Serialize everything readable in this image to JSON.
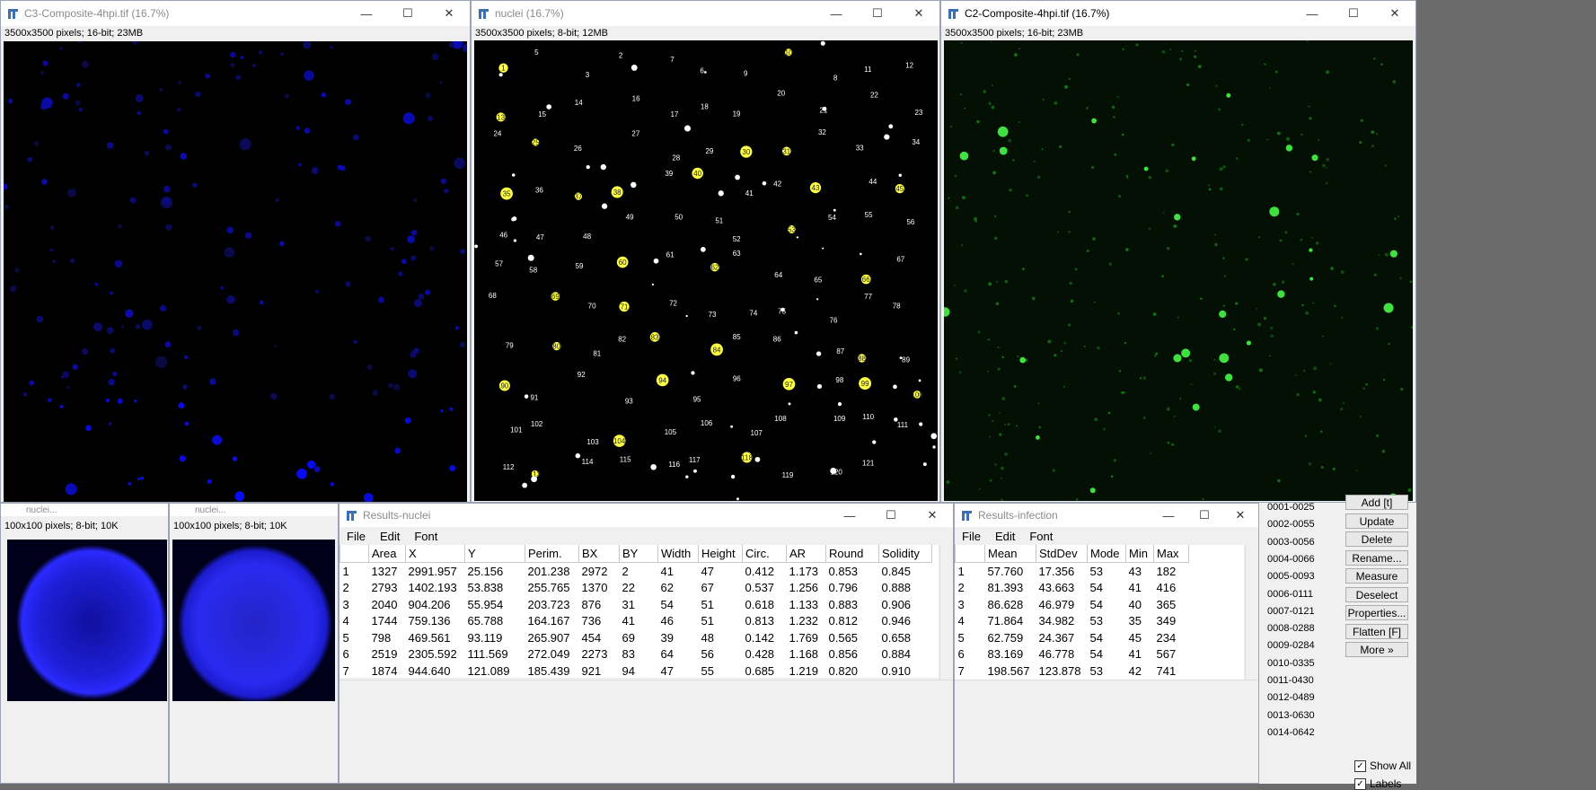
{
  "windows": {
    "c3": {
      "title": "C3-Composite-4hpi.tif (16.7%)",
      "info": "3500x3500 pixels; 16-bit; 23MB"
    },
    "nuclei": {
      "title": "nuclei (16.7%)",
      "info": "3500x3500 pixels; 8-bit; 12MB"
    },
    "c2": {
      "title": "C2-Composite-4hpi.tif (16.7%)",
      "info": "3500x3500 pixels; 16-bit; 23MB"
    },
    "crop1": {
      "title": "nuclei...",
      "info": "100x100 pixels; 8-bit; 10K"
    },
    "crop2": {
      "title": "nuclei...",
      "info": "100x100 pixels; 8-bit; 10K"
    }
  },
  "controls": {
    "minimize": "—",
    "maximize": "☐",
    "close": "✕"
  },
  "nuclei_labels": [
    "1",
    "5",
    "3",
    "2",
    "7",
    "6",
    "9",
    "10",
    "8",
    "11",
    "12",
    "13",
    "15",
    "14",
    "16",
    "17",
    "18",
    "19",
    "20",
    "21",
    "22",
    "23",
    "24",
    "25",
    "26",
    "27",
    "28",
    "29",
    "30",
    "31",
    "32",
    "33",
    "34",
    "35",
    "36",
    "37",
    "38",
    "39",
    "40",
    "41",
    "42",
    "43",
    "44",
    "45",
    "46",
    "47",
    "48",
    "49",
    "50",
    "51",
    "52",
    "53",
    "54",
    "55",
    "56",
    "57",
    "58",
    "59",
    "60",
    "61",
    "62",
    "63",
    "64",
    "65",
    "66",
    "67",
    "68",
    "69",
    "70",
    "71",
    "72",
    "73",
    "74",
    "75",
    "76",
    "77",
    "78",
    "79",
    "80",
    "81",
    "82",
    "83",
    "84",
    "85",
    "86",
    "87",
    "88",
    "89",
    "90",
    "91",
    "92",
    "93",
    "94",
    "95",
    "96",
    "97",
    "98",
    "99",
    "100",
    "101",
    "102",
    "103",
    "104",
    "105",
    "106",
    "107",
    "108",
    "109",
    "110",
    "111",
    "112",
    "113",
    "114",
    "115",
    "116",
    "117",
    "118",
    "119",
    "120",
    "121"
  ],
  "results_nuclei": {
    "title": "Results-nuclei",
    "menu": [
      "File",
      "Edit",
      "Font"
    ],
    "columns": [
      "",
      "Area",
      "X",
      "Y",
      "Perim.",
      "BX",
      "BY",
      "Width",
      "Height",
      "Circ.",
      "AR",
      "Round",
      "Solidity"
    ],
    "rows": [
      [
        "1",
        "1327",
        "2991.957",
        "25.156",
        "201.238",
        "2972",
        "2",
        "41",
        "47",
        "0.412",
        "1.173",
        "0.853",
        "0.845"
      ],
      [
        "2",
        "2793",
        "1402.193",
        "53.838",
        "255.765",
        "1370",
        "22",
        "62",
        "67",
        "0.537",
        "1.256",
        "0.796",
        "0.888"
      ],
      [
        "3",
        "2040",
        "904.206",
        "55.954",
        "203.723",
        "876",
        "31",
        "54",
        "51",
        "0.618",
        "1.133",
        "0.883",
        "0.906"
      ],
      [
        "4",
        "1744",
        "759.136",
        "65.788",
        "164.167",
        "736",
        "41",
        "46",
        "51",
        "0.813",
        "1.232",
        "0.812",
        "0.946"
      ],
      [
        "5",
        "798",
        "469.561",
        "93.119",
        "265.907",
        "454",
        "69",
        "39",
        "48",
        "0.142",
        "1.769",
        "0.565",
        "0.658"
      ],
      [
        "6",
        "2519",
        "2305.592",
        "111.569",
        "272.049",
        "2273",
        "83",
        "64",
        "56",
        "0.428",
        "1.168",
        "0.856",
        "0.884"
      ],
      [
        "7",
        "1874",
        "944.640",
        "121.089",
        "185.439",
        "921",
        "94",
        "47",
        "55",
        "0.685",
        "1.219",
        "0.820",
        "0.910"
      ]
    ]
  },
  "results_infection": {
    "title": "Results-infection",
    "menu": [
      "File",
      "Edit",
      "Font"
    ],
    "columns": [
      "",
      "Mean",
      "StdDev",
      "Mode",
      "Min",
      "Max"
    ],
    "rows": [
      [
        "1",
        "57.760",
        "17.356",
        "53",
        "43",
        "182"
      ],
      [
        "2",
        "81.393",
        "43.663",
        "54",
        "41",
        "416"
      ],
      [
        "3",
        "86.628",
        "46.979",
        "54",
        "40",
        "365"
      ],
      [
        "4",
        "71.864",
        "34.982",
        "53",
        "35",
        "349"
      ],
      [
        "5",
        "62.759",
        "24.367",
        "54",
        "45",
        "234"
      ],
      [
        "6",
        "83.169",
        "46.778",
        "54",
        "41",
        "567"
      ],
      [
        "7",
        "198.567",
        "123.878",
        "53",
        "42",
        "741"
      ]
    ]
  },
  "roi_manager": {
    "items": [
      "0001-0025",
      "0002-0055",
      "0003-0056",
      "0004-0066",
      "0005-0093",
      "0006-0111",
      "0007-0121",
      "0008-0288",
      "0009-0284",
      "0010-0335",
      "0011-0430",
      "0012-0489",
      "0013-0630",
      "0014-0642"
    ],
    "buttons": [
      "Add [t]",
      "Update",
      "Delete",
      "Rename...",
      "Measure",
      "Deselect",
      "Properties...",
      "Flatten [F]",
      "More »"
    ],
    "show_all": "Show All",
    "labels": "Labels",
    "check": "✓"
  },
  "colors": {
    "blue_nuclei": "#1a1aff",
    "green_signal": "#3fe03f",
    "label_yellow": "#ffff44"
  }
}
